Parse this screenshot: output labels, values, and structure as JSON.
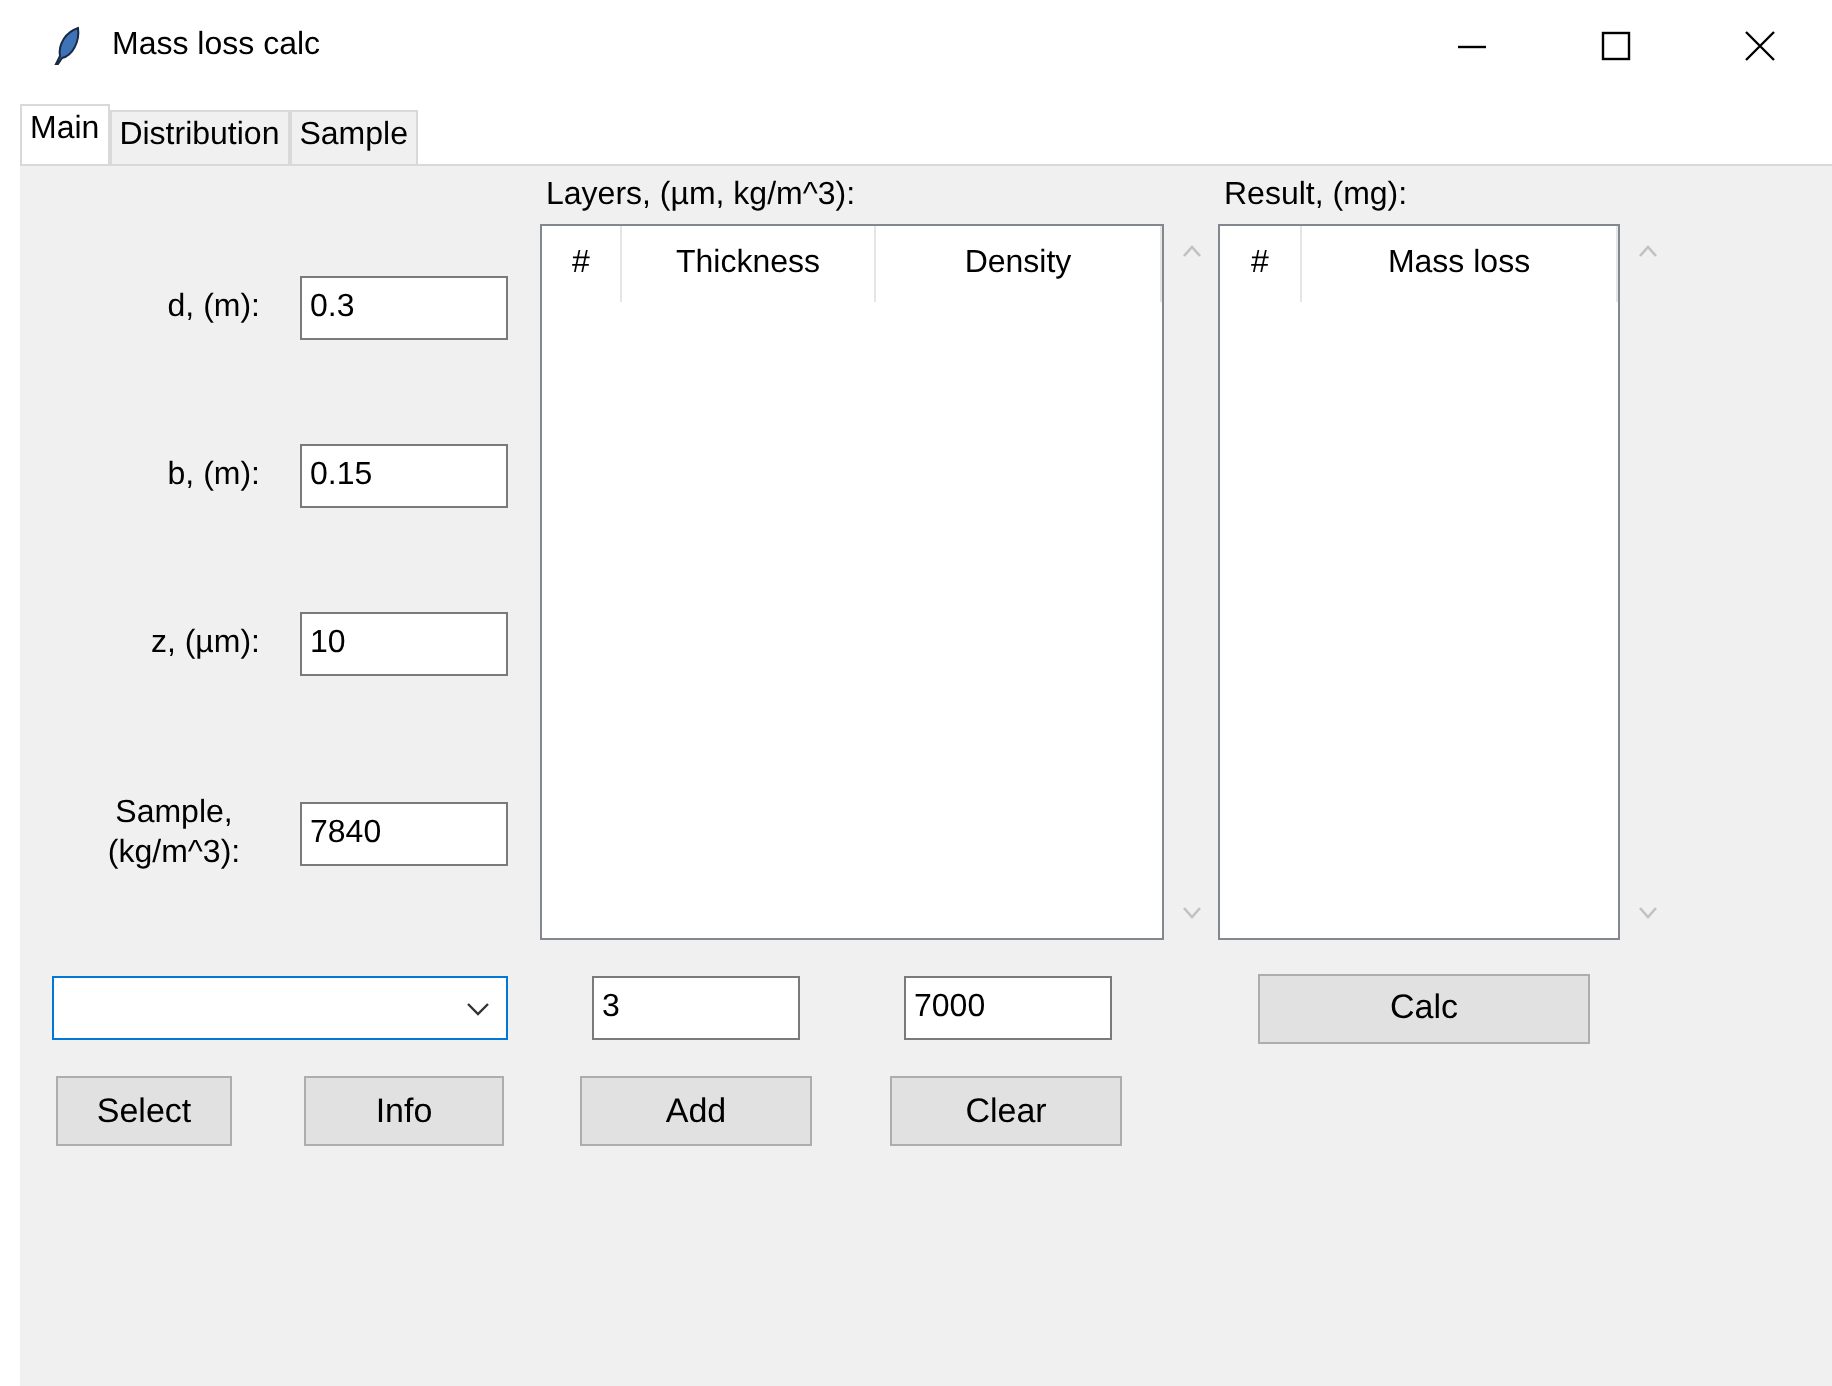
{
  "window": {
    "title": "Mass loss calc"
  },
  "tabs": [
    {
      "label": "Main",
      "selected": true
    },
    {
      "label": "Distribution",
      "selected": false
    },
    {
      "label": "Sample",
      "selected": false
    }
  ],
  "fields": [
    {
      "label": "d, (m):",
      "value": "0.3"
    },
    {
      "label": "b, (m):",
      "value": "0.15"
    },
    {
      "label": "z, (µm):",
      "value": "10"
    },
    {
      "label": "Sample, (kg/m^3):",
      "value": "7840"
    }
  ],
  "layers": {
    "label": "Layers, (µm, kg/m^3):",
    "columns": [
      "#",
      "Thickness",
      "Density"
    ]
  },
  "result": {
    "label": "Result, (mg):",
    "columns": [
      "#",
      "Mass loss"
    ]
  },
  "thickness_input": {
    "value": "3"
  },
  "density_input": {
    "value": "7000"
  },
  "calc_button": "Calc",
  "buttons": [
    "Select",
    "Info",
    "Add",
    "Clear"
  ]
}
